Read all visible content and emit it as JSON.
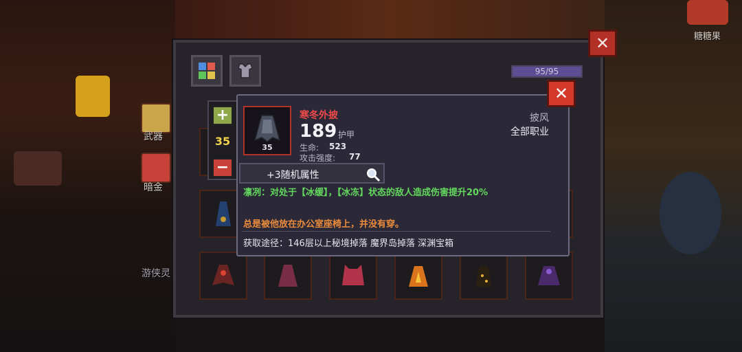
{
  "side": {
    "weapon_label": "武器",
    "gold_label": "暗金",
    "ranger_label": "游侠灵",
    "candy_label": "糖糖果"
  },
  "energy": {
    "text": "95/95",
    "fraction": 1.0
  },
  "stepper": {
    "value": "35",
    "plus_glyph": "+",
    "minus_glyph": "−"
  },
  "tooltip": {
    "name": "寒冬外披",
    "armor_value": "189",
    "armor_unit": "护甲",
    "item_level": "35",
    "stats": [
      {
        "label": "生命:",
        "value": "523"
      },
      {
        "label": "攻击强度:",
        "value": "77"
      }
    ],
    "item_type": "披风",
    "item_class": "全部职业",
    "random_attr": "+3随机属性",
    "effect": "凛冽：对处于【冰缓】，【冰冻】状态的敌人造成伤害提升20%",
    "flavor": "总是被他放在办公室座椅上，并没有穿。",
    "source": "获取途径：146层以上秘境掉落 魔界岛掉落 深渊宝箱"
  },
  "icons": {
    "close": "close-icon",
    "magnifier": "magnifier-icon",
    "inventory_tab": "grid-icon",
    "character_tab": "armor-icon"
  },
  "colors": {
    "item_name": "#ef4a4a",
    "effect": "#63d85e",
    "flavor": "#eb8b3c",
    "qty": "#f2d24a",
    "close": "#d33a2c"
  }
}
